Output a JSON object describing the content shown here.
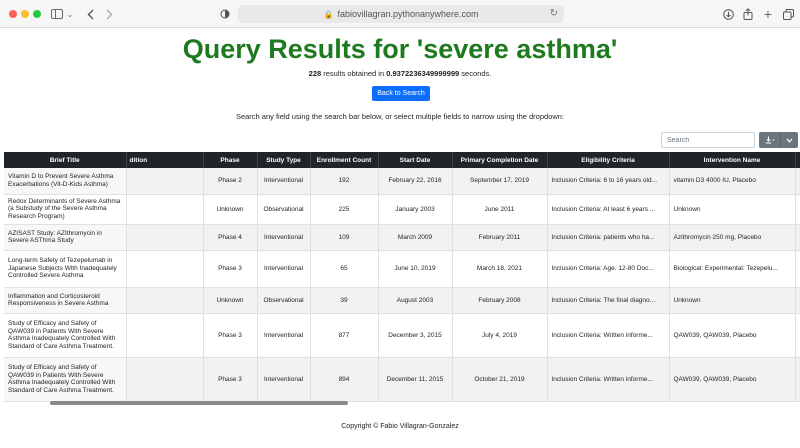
{
  "browser": {
    "url": "fabiovillagran.pythonanywhere.com"
  },
  "page": {
    "title": "Query Results for 'severe asthma'",
    "summary": {
      "count": "228",
      "mid": " results obtained in ",
      "time": "0.9372236349999999",
      "tail": " seconds."
    },
    "back_button": "Back to Search",
    "hint": "Search any field using the search bar below, or select multiple fields to narrow using the dropdown:",
    "search_placeholder": "Search",
    "footer": "Copyright © Fabio Villagran-Gonzalez"
  },
  "table": {
    "headers": {
      "brief": "Brief Title",
      "cut": "dition",
      "phase": "Phase",
      "study_type": "Study Type",
      "enrollment": "Enrollment Count",
      "start": "Start Date",
      "completion": "Primary Completion Date",
      "eligibility": "Eligibility Criteria",
      "intervention": "Intervention Name"
    },
    "rows": [
      {
        "brief": "Vitamin D to Prevent Severe Asthma Exacerbations (Vit-D-Kids Asthma)",
        "phase": "Phase 2",
        "study_type": "Interventional",
        "enrollment": "192",
        "start": "February 22, 2016",
        "completion": "September 17, 2019",
        "eligibility": "Inclusion Criteria: 6 to 16 years old...",
        "intervention": "vitamin D3 4000 IU, Placebo",
        "edge": "I"
      },
      {
        "brief": "Redox Determinants of Severe Asthma (a Substudy of the Severe Asthma Research Program)",
        "phase": "Unknown",
        "study_type": "Observational",
        "enrollment": "225",
        "start": "January 2003",
        "completion": "June 2011",
        "eligibility": "Inclusion Criteria: At least 6 years ...",
        "intervention": "Unknown",
        "edge": "U"
      },
      {
        "brief": "AZISAST Study: AZIthromycin in Severe ASThma Study",
        "phase": "Phase 4",
        "study_type": "Interventional",
        "enrollment": "109",
        "start": "March 2009",
        "completion": "February 2011",
        "eligibility": "Inclusion Criteria: patients who ha...",
        "intervention": "Azithromycin 250 mg, Placebo",
        "edge": "I"
      },
      {
        "brief": "Long-term Safety of Tezepelumab in Japanese Subjects With Inadequately Controlled Severe Asthma",
        "phase": "Phase 3",
        "study_type": "Interventional",
        "enrollment": "65",
        "start": "June 10, 2019",
        "completion": "March 18, 2021",
        "eligibility": "Inclusion Criteria: Age. 12-80 Doc...",
        "intervention": "Biological: Experimental: Tezepelu...",
        "edge": "I"
      },
      {
        "brief": "Inflammation and Corticosteroid Responsiveness in Severe Asthma",
        "phase": "Unknown",
        "study_type": "Observational",
        "enrollment": "39",
        "start": "August 2003",
        "completion": "February 2008",
        "eligibility": "Inclusion Criteria: The final diagno...",
        "intervention": "Unknown",
        "edge": "U"
      },
      {
        "brief": "Study of Efficacy and Safety of QAW039 in Patients With Severe Asthma Inadequately Controlled With Standard of Care Asthma Treatment.",
        "phase": "Phase 3",
        "study_type": "Interventional",
        "enrollment": "877",
        "start": "December 3, 2015",
        "completion": "July 4, 2019",
        "eligibility": "Inclusion Criteria: Written informe...",
        "intervention": "QAW039, QAW039, Placebo",
        "edge": "I"
      },
      {
        "brief": "Study of Efficacy and Safety of QAW039 in Patients With Severe Asthma Inadequately Controlled With Standard of Care Asthma Treatment.",
        "phase": "Phase 3",
        "study_type": "Interventional",
        "enrollment": "894",
        "start": "December 11, 2015",
        "completion": "October 21, 2019",
        "eligibility": "Inclusion Criteria: Written informe...",
        "intervention": "QAW039, QAW039, Placebo",
        "edge": "I"
      }
    ]
  },
  "colors": {
    "title": "#1e7a1e",
    "primary_button": "#0d6efd",
    "header_bg": "#212529",
    "toolbar_button": "#6c757d"
  }
}
